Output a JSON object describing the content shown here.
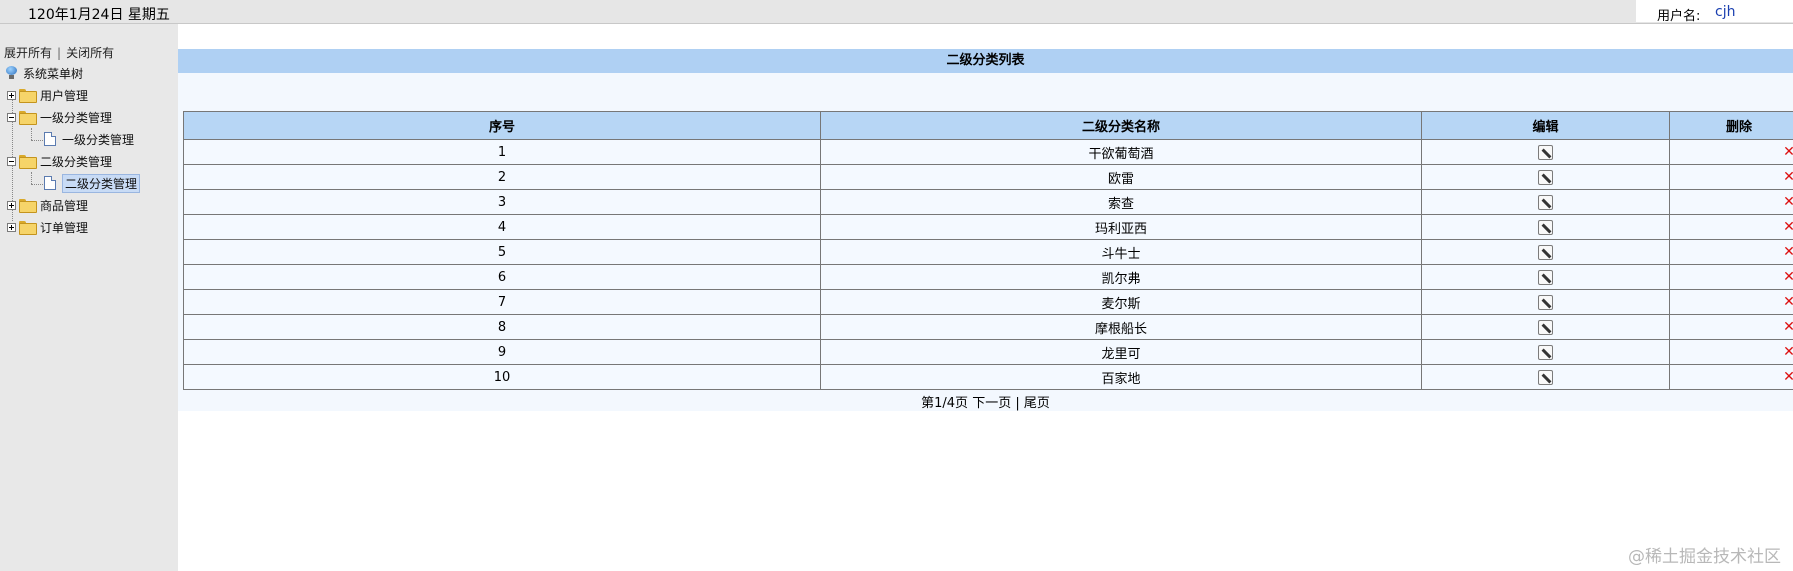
{
  "header": {
    "date": "120年1月24日 星期五",
    "user_label": "用户名:",
    "user_name": "cjh"
  },
  "sidebar": {
    "expand_all": "展开所有",
    "collapse_all": "关闭所有",
    "separator": "|",
    "root": "系统菜单树",
    "items": [
      {
        "label": "用户管理",
        "state": "collapsed"
      },
      {
        "label": "一级分类管理",
        "state": "expanded",
        "children": [
          "一级分类管理"
        ]
      },
      {
        "label": "二级分类管理",
        "state": "expanded",
        "children": [
          "二级分类管理"
        ]
      },
      {
        "label": "商品管理",
        "state": "collapsed"
      },
      {
        "label": "订单管理",
        "state": "collapsed"
      }
    ]
  },
  "main": {
    "title": "二级分类列表",
    "columns": [
      "序号",
      "二级分类名称",
      "编辑",
      "删除"
    ],
    "rows": [
      {
        "index": "1",
        "name": "干欲葡萄酒"
      },
      {
        "index": "2",
        "name": "欧雷"
      },
      {
        "index": "3",
        "name": "索查"
      },
      {
        "index": "4",
        "name": "玛利亚西"
      },
      {
        "index": "5",
        "name": "斗牛士"
      },
      {
        "index": "6",
        "name": "凯尔弗"
      },
      {
        "index": "7",
        "name": "麦尔斯"
      },
      {
        "index": "8",
        "name": "摩根船长"
      },
      {
        "index": "9",
        "name": "龙里可"
      },
      {
        "index": "10",
        "name": "百家地"
      }
    ],
    "pager": {
      "page_info": "第1/4页",
      "next": "下一页",
      "separator": "|",
      "last": "尾页"
    }
  },
  "watermark": "@稀土掘金技术社区"
}
